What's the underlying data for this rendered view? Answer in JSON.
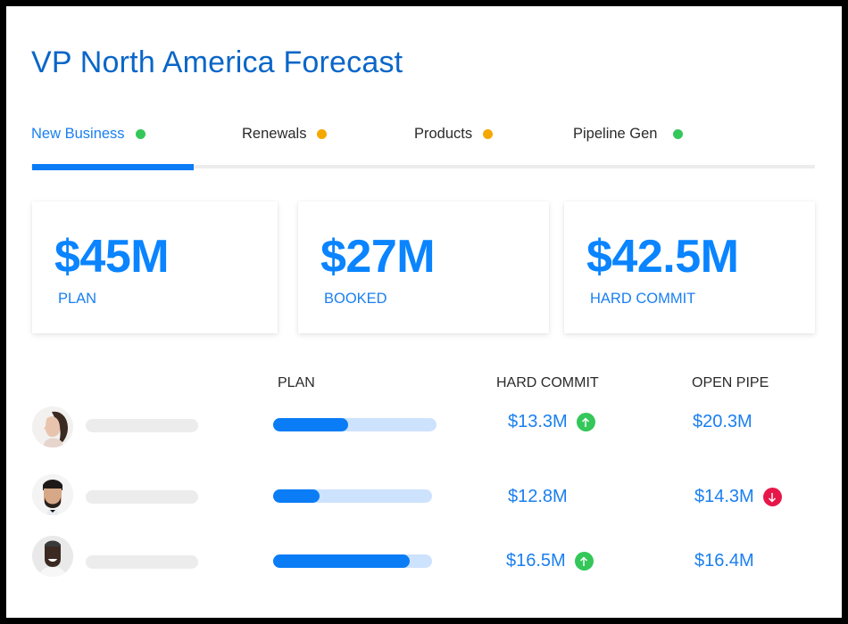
{
  "header": {
    "title": "VP North America Forecast"
  },
  "tabs": [
    {
      "label": "New Business",
      "status": "green",
      "status_color": "#34c759",
      "active": true
    },
    {
      "label": "Renewals",
      "status": "amber",
      "status_color": "#f5a800",
      "active": false
    },
    {
      "label": "Products",
      "status": "amber",
      "status_color": "#f5a800",
      "active": false
    },
    {
      "label": "Pipeline Gen",
      "status": "green",
      "status_color": "#34c759",
      "active": false
    }
  ],
  "summary_cards": [
    {
      "value": "$45M",
      "label": "PLAN"
    },
    {
      "value": "$27M",
      "label": "BOOKED"
    },
    {
      "value": "$42.5M",
      "label": "HARD COMMIT"
    }
  ],
  "table": {
    "columns": [
      "PLAN",
      "HARD COMMIT",
      "OPEN PIPE"
    ],
    "rows": [
      {
        "avatar": "woman-portrait",
        "plan_progress_pct": 46,
        "hard_commit": "$13.3M",
        "hard_commit_trend": "up",
        "open_pipe": "$20.3M",
        "open_pipe_trend": null
      },
      {
        "avatar": "bearded-man-portrait",
        "plan_progress_pct": 29,
        "hard_commit": "$12.8M",
        "hard_commit_trend": null,
        "open_pipe": "$14.3M",
        "open_pipe_trend": "down"
      },
      {
        "avatar": "smiling-man-portrait",
        "plan_progress_pct": 86,
        "hard_commit": "$16.5M",
        "hard_commit_trend": "up",
        "open_pipe": "$16.4M",
        "open_pipe_trend": null
      }
    ]
  },
  "colors": {
    "accent": "#0a7cf6",
    "title": "#0a66c8",
    "trend_up": "#34c759",
    "trend_down": "#e8174a",
    "progress_track": "#cde2fd"
  }
}
